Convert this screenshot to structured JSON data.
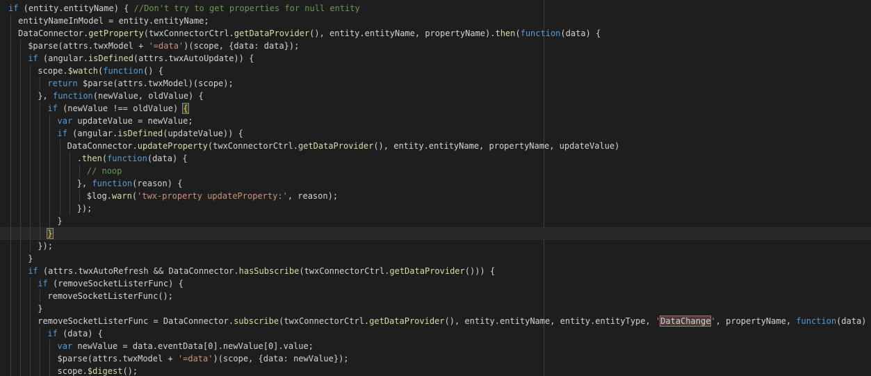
{
  "editor": {
    "language": "javascript",
    "theme": "dark",
    "cursor_line_index": 18,
    "lines": [
      {
        "indent": 0,
        "tokens": [
          [
            "kw",
            "if"
          ],
          [
            "pl",
            " (entity.entityName) { "
          ],
          [
            "com",
            "//Don't try to get properties for null entity"
          ]
        ]
      },
      {
        "indent": 1,
        "tokens": [
          [
            "pl",
            "entityNameInModel = entity.entityName;"
          ]
        ]
      },
      {
        "indent": 1,
        "tokens": [
          [
            "pl",
            "DataConnector."
          ],
          [
            "fn",
            "getProperty"
          ],
          [
            "pl",
            "(twxConnectorCtrl."
          ],
          [
            "fn",
            "getDataProvider"
          ],
          [
            "pl",
            "(), entity.entityName, propertyName)."
          ],
          [
            "fn",
            "then"
          ],
          [
            "pl",
            "("
          ],
          [
            "kw",
            "function"
          ],
          [
            "pl",
            "(data) {"
          ]
        ]
      },
      {
        "indent": 2,
        "tokens": [
          [
            "pl",
            "$parse(attrs.twxModel + "
          ],
          [
            "str",
            "'=data'"
          ],
          [
            "pl",
            ")(scope, {data: data});"
          ]
        ]
      },
      {
        "indent": 2,
        "tokens": [
          [
            "kw",
            "if"
          ],
          [
            "pl",
            " (angular."
          ],
          [
            "fn",
            "isDefined"
          ],
          [
            "pl",
            "(attrs.twxAutoUpdate)) {"
          ]
        ]
      },
      {
        "indent": 3,
        "tokens": [
          [
            "pl",
            "scope."
          ],
          [
            "fn",
            "$watch"
          ],
          [
            "pl",
            "("
          ],
          [
            "kw",
            "function"
          ],
          [
            "pl",
            "() {"
          ]
        ]
      },
      {
        "indent": 4,
        "tokens": [
          [
            "kw",
            "return"
          ],
          [
            "pl",
            " $parse(attrs.twxModel)(scope);"
          ]
        ]
      },
      {
        "indent": 3,
        "tokens": [
          [
            "pl",
            "}, "
          ],
          [
            "kw",
            "function"
          ],
          [
            "pl",
            "(newValue, oldValue) {"
          ]
        ]
      },
      {
        "indent": 4,
        "tokens": [
          [
            "kw",
            "if"
          ],
          [
            "pl",
            " (newValue !== oldValue) "
          ],
          [
            "br",
            "{"
          ]
        ]
      },
      {
        "indent": 5,
        "tokens": [
          [
            "kw",
            "var"
          ],
          [
            "pl",
            " updateValue = newValue;"
          ]
        ]
      },
      {
        "indent": 5,
        "tokens": [
          [
            "kw",
            "if"
          ],
          [
            "pl",
            " (angular."
          ],
          [
            "fn",
            "isDefined"
          ],
          [
            "pl",
            "(updateValue)) {"
          ]
        ]
      },
      {
        "indent": 6,
        "tokens": [
          [
            "pl",
            "DataConnector."
          ],
          [
            "fn",
            "updateProperty"
          ],
          [
            "pl",
            "(twxConnectorCtrl."
          ],
          [
            "fn",
            "getDataProvider"
          ],
          [
            "pl",
            "(), entity.entityName, propertyName, updateValue)"
          ]
        ]
      },
      {
        "indent": 7,
        "tokens": [
          [
            "pl",
            "."
          ],
          [
            "fn",
            "then"
          ],
          [
            "pl",
            "("
          ],
          [
            "kw",
            "function"
          ],
          [
            "pl",
            "(data) {"
          ]
        ]
      },
      {
        "indent": 8,
        "tokens": [
          [
            "com",
            "// noop"
          ]
        ]
      },
      {
        "indent": 7,
        "tokens": [
          [
            "pl",
            "}, "
          ],
          [
            "kw",
            "function"
          ],
          [
            "pl",
            "(reason) {"
          ]
        ]
      },
      {
        "indent": 8,
        "tokens": [
          [
            "pl",
            "$log."
          ],
          [
            "fn",
            "warn"
          ],
          [
            "pl",
            "("
          ],
          [
            "str",
            "'twx-property updateProperty:'"
          ],
          [
            "pl",
            ", reason);"
          ]
        ]
      },
      {
        "indent": 7,
        "tokens": [
          [
            "pl",
            "});"
          ]
        ]
      },
      {
        "indent": 5,
        "tokens": [
          [
            "pl",
            "}"
          ]
        ]
      },
      {
        "indent": 4,
        "tokens": [
          [
            "br",
            "}"
          ]
        ]
      },
      {
        "indent": 3,
        "tokens": [
          [
            "pl",
            "});"
          ]
        ]
      },
      {
        "indent": 2,
        "tokens": [
          [
            "pl",
            "}"
          ]
        ]
      },
      {
        "indent": 2,
        "tokens": [
          [
            "kw",
            "if"
          ],
          [
            "pl",
            " (attrs.twxAutoRefresh && DataConnector."
          ],
          [
            "fn",
            "hasSubscribe"
          ],
          [
            "pl",
            "(twxConnectorCtrl."
          ],
          [
            "fn",
            "getDataProvider"
          ],
          [
            "pl",
            "())) {"
          ]
        ]
      },
      {
        "indent": 3,
        "tokens": [
          [
            "kw",
            "if"
          ],
          [
            "pl",
            " (removeSocketListerFunc) {"
          ]
        ]
      },
      {
        "indent": 4,
        "tokens": [
          [
            "pl",
            "removeSocketListerFunc();"
          ]
        ]
      },
      {
        "indent": 3,
        "tokens": [
          [
            "pl",
            "}"
          ]
        ]
      },
      {
        "indent": 3,
        "tokens": [
          [
            "pl",
            "removeSocketListerFunc = DataConnector."
          ],
          [
            "fn",
            "subscribe"
          ],
          [
            "pl",
            "(twxConnectorCtrl."
          ],
          [
            "fn",
            "getDataProvider"
          ],
          [
            "pl",
            "(), entity.entityName, entity.entityType, "
          ],
          [
            "str",
            "'"
          ],
          [
            "sel",
            "DataChange"
          ],
          [
            "str",
            "'"
          ],
          [
            "pl",
            ", propertyName, "
          ],
          [
            "kw",
            "function"
          ],
          [
            "pl",
            "(data) {"
          ]
        ]
      },
      {
        "indent": 4,
        "tokens": [
          [
            "kw",
            "if"
          ],
          [
            "pl",
            " (data) {"
          ]
        ]
      },
      {
        "indent": 5,
        "tokens": [
          [
            "kw",
            "var"
          ],
          [
            "pl",
            " newValue = data.eventData[0].newValue[0].value;"
          ]
        ]
      },
      {
        "indent": 5,
        "tokens": [
          [
            "pl",
            "$parse(attrs.twxModel + "
          ],
          [
            "str",
            "'=data'"
          ],
          [
            "pl",
            ")(scope, {data: newValue});"
          ]
        ]
      },
      {
        "indent": 5,
        "tokens": [
          [
            "pl",
            "scope."
          ],
          [
            "fn",
            "$digest"
          ],
          [
            "pl",
            "();"
          ]
        ]
      }
    ]
  }
}
